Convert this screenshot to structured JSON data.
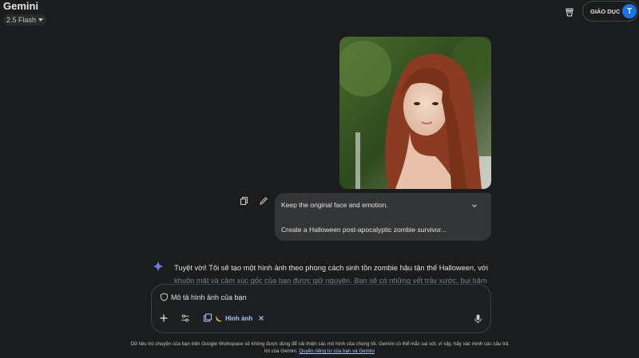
{
  "app": {
    "title": "Gemini",
    "model": "2.5 Flash"
  },
  "header": {
    "edu_label": "GIÁO DỤC",
    "avatar_letter": "T"
  },
  "user_message": {
    "line1": "Keep the original face and emotion.",
    "line2": "Create a Halloween post-apocalyptic zombie survivor..."
  },
  "response": {
    "visible": "Tuyệt vời! Tôi sẽ tạo một hình ảnh theo phong cách sinh tồn zombie hậu tận thế Halloween, với",
    "faded": "khuôn mặt và cảm xúc gốc của bạn được giữ nguyên. Bạn sẽ có những vết trầy xước, bụi bặm"
  },
  "input": {
    "placeholder": "Mô tả hình ảnh của bạn",
    "tool_chip": "Hình ảnh"
  },
  "footer": {
    "text": "Dữ liệu trò chuyện của bạn trên Google Workspace sẽ không được dùng để cải thiện các mô hình của chúng tôi. Gemini có thể mắc sai sót, vì vậy, hãy xác minh các câu trả lời của Gemini.",
    "link": "Quyền riêng tư của bạn và Gemini"
  },
  "icons": [
    "bucket-icon",
    "copy-icon",
    "edit-icon",
    "chevron-down-icon",
    "sparkle-icon",
    "shield-icon",
    "plus-icon",
    "tune-icon",
    "image-gallery-icon",
    "banana-icon",
    "close-icon",
    "mic-icon"
  ],
  "colors": {
    "background": "#1b1c1d",
    "bubble": "#333537",
    "accent": "#a8c7fa",
    "avatar": "#1a73e8"
  }
}
